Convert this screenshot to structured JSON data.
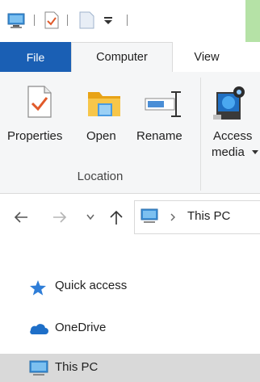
{
  "quick_access_toolbar": {
    "icons": [
      "computer-icon",
      "properties-icon",
      "new-folder-icon",
      "customize-dropdown-icon"
    ]
  },
  "ribbon": {
    "tabs": [
      {
        "label": "File"
      },
      {
        "label": "Computer"
      },
      {
        "label": "View"
      }
    ],
    "buttons": {
      "properties": "Properties",
      "open": "Open",
      "rename": "Rename",
      "access_media_line1": "Access",
      "access_media_line2": "media"
    },
    "group_label": "Location"
  },
  "address_bar": {
    "path": "This PC"
  },
  "nav_pane": {
    "items": [
      {
        "label": "Quick access",
        "icon": "quick-access-star-icon"
      },
      {
        "label": "OneDrive",
        "icon": "onedrive-cloud-icon"
      },
      {
        "label": "This PC",
        "icon": "this-pc-icon",
        "selected": true
      }
    ]
  },
  "colors": {
    "file_tab": "#1a5fb4",
    "ribbon_bg": "#f5f6f7",
    "selected_bg": "#d9d9d9"
  }
}
